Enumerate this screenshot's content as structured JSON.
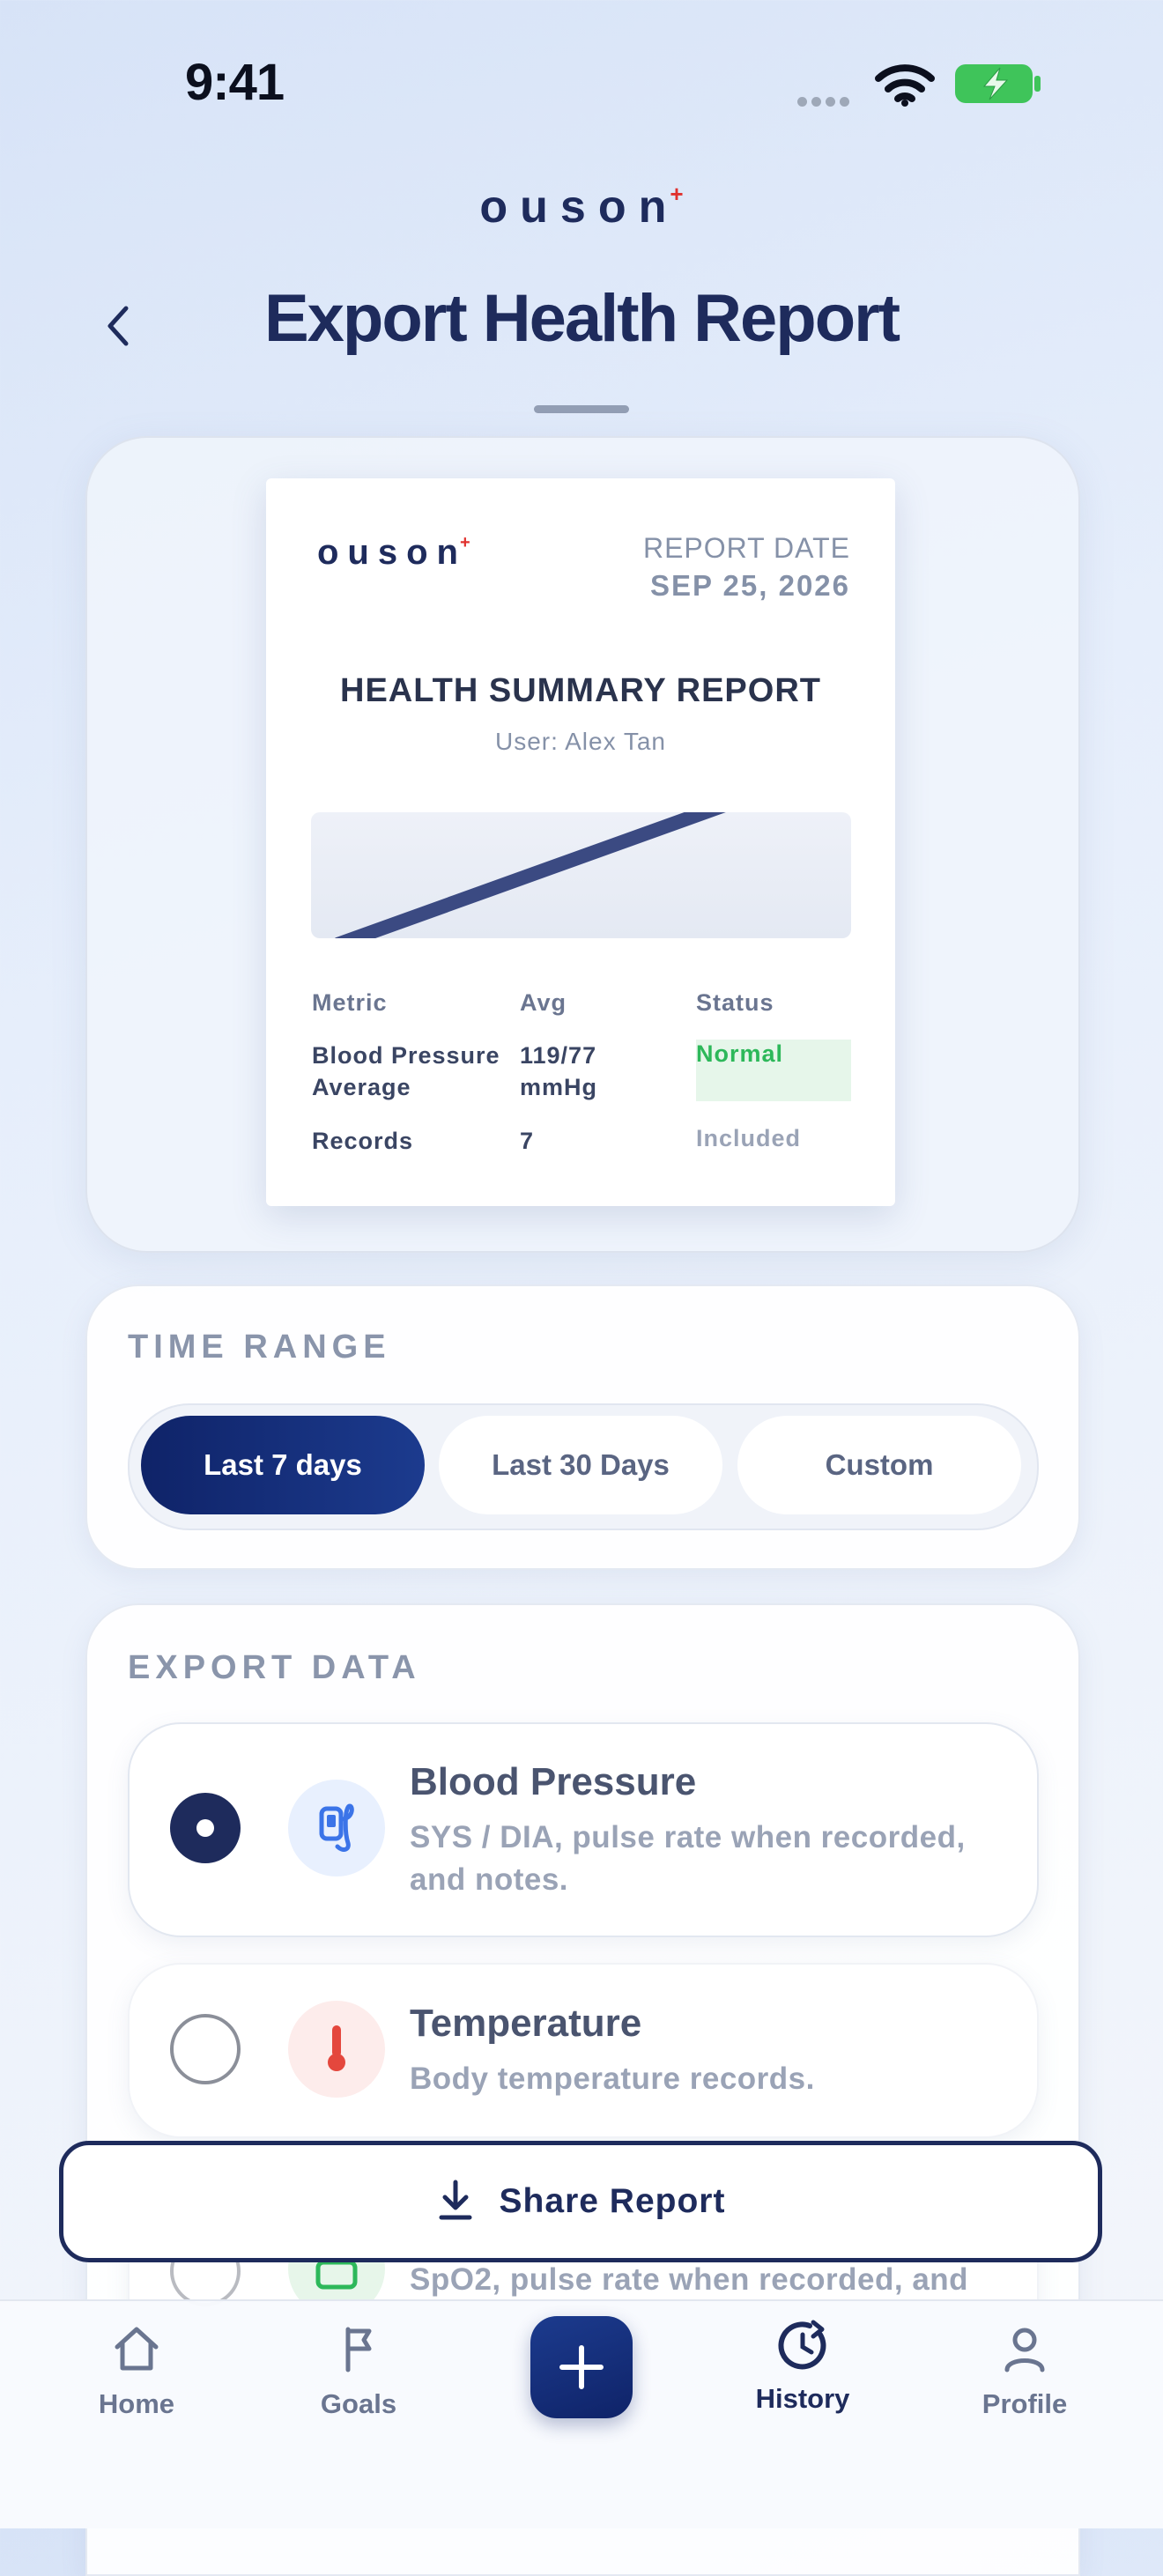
{
  "status_bar": {
    "time": "9:41"
  },
  "brand": {
    "name": "ouson",
    "mark": "+"
  },
  "header": {
    "title": "Export Health Report"
  },
  "report_preview": {
    "brand": "ouson",
    "date_label": "REPORT DATE",
    "date": "SEP 25, 2026",
    "title": "HEALTH SUMMARY REPORT",
    "user": "User: Alex Tan",
    "table": {
      "headers": [
        "Metric",
        "Avg",
        "Status"
      ],
      "rows": [
        {
          "metric_l1": "Blood Pressure",
          "metric_l2": "Average",
          "avg_l1": "119/77",
          "avg_l2": "mmHg",
          "status": "Normal"
        },
        {
          "metric_l1": "Records",
          "metric_l2": "",
          "avg_l1": "7",
          "avg_l2": "",
          "status": "Included"
        }
      ]
    }
  },
  "time_range": {
    "label": "TIME RANGE",
    "options": [
      "Last 7 days",
      "Last 30 Days",
      "Custom"
    ],
    "selected": "Last 7 days"
  },
  "export_data": {
    "label": "EXPORT DATA",
    "items": [
      {
        "title": "Blood Pressure",
        "desc_l1": "SYS / DIA, pulse rate when recorded,",
        "desc_l2": "and notes.",
        "selected": true,
        "icon": "blood-pressure-cuff-icon"
      },
      {
        "title": "Temperature",
        "desc_l1": "Body temperature records.",
        "desc_l2": "",
        "selected": false,
        "icon": "thermometer-icon"
      },
      {
        "title": "",
        "desc_l1": "SpO2, pulse rate when recorded, and",
        "desc_l2": "",
        "selected": false,
        "icon": "oximeter-icon"
      }
    ]
  },
  "share_button": {
    "label": "Share Report",
    "icon": "download-icon"
  },
  "tab_bar": {
    "items": [
      {
        "label": "Home",
        "icon": "home-icon"
      },
      {
        "label": "Goals",
        "icon": "flag-icon"
      },
      {
        "label": "History",
        "icon": "history-icon",
        "active": true
      },
      {
        "label": "Profile",
        "icon": "profile-icon"
      }
    ],
    "fab_icon": "plus-icon"
  },
  "colors": {
    "navy": "#1e2b5c",
    "accent_red": "#e0312e",
    "normal_green": "#2db85a"
  }
}
